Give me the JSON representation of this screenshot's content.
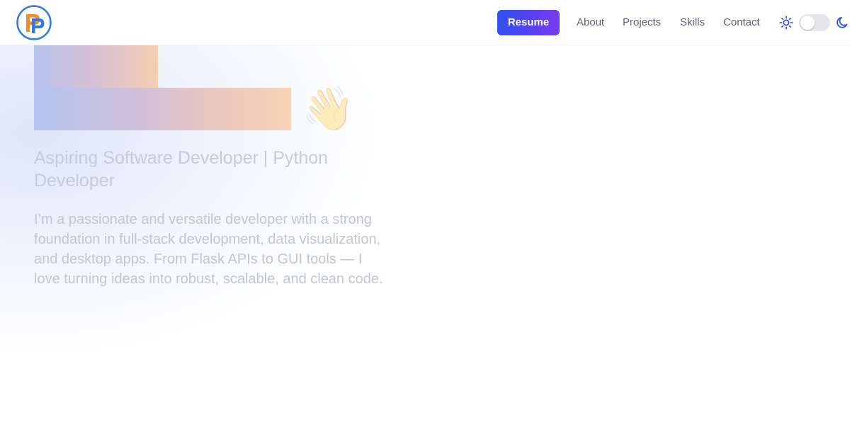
{
  "navbar": {
    "logo_alt": "PP",
    "resume_label": "Resume",
    "links": [
      "About",
      "Projects",
      "Skills",
      "Contact"
    ],
    "icons": {
      "light": "sun-icon",
      "dark": "moon-icon",
      "theme_toggle": "off"
    }
  },
  "hero": {
    "wave_emoji": "👋",
    "subtitle": "Aspiring Software Developer | Python Developer",
    "intro": "I’m a passionate and versatile developer with a strong foundation in full-stack development, data visualization, and desktop apps. From Flask APIs to GUI tools — I love turning ideas into robust, scalable, and clean code."
  },
  "colors": {
    "resume_gradient_start": "#2f55f0",
    "resume_gradient_end": "#7a3cf0",
    "logo_orange": "#f28c28",
    "logo_blue": "#2f7be0",
    "nav_text": "#5b6472"
  }
}
